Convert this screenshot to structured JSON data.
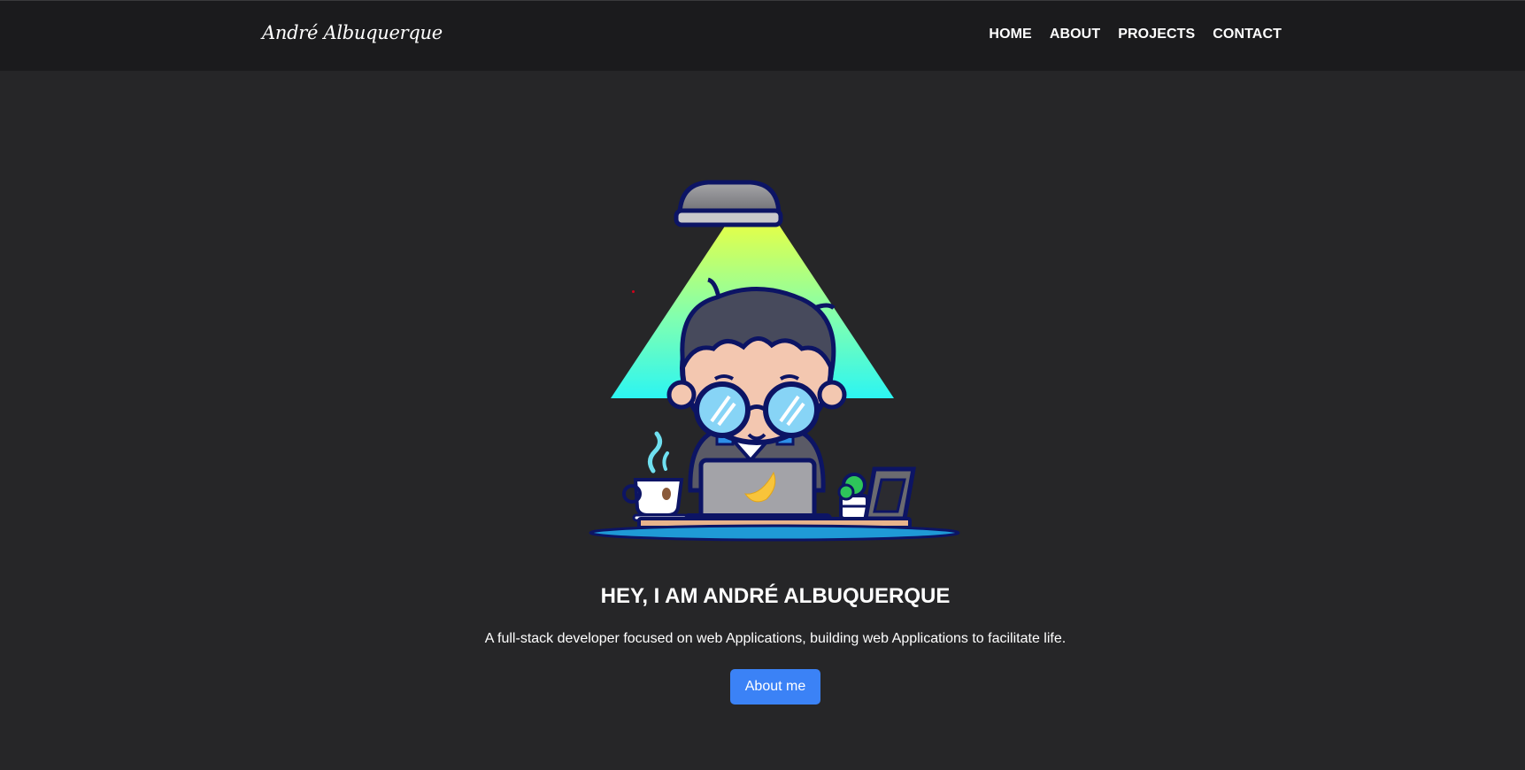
{
  "nav": {
    "brand": "André Albuquerque",
    "links": [
      "HOME",
      "ABOUT",
      "PROJECTS",
      "CONTACT"
    ]
  },
  "hero": {
    "illustration": "developer-at-laptop-under-lamp",
    "title": "HEY, I AM ANDRÉ ALBUQUERQUE",
    "subtitle": "A full-stack developer focused on web Applications, building web Applications to facilitate life.",
    "button_label": "About me"
  },
  "colors": {
    "page_bg": "#262628",
    "navbar_bg": "#1b1b1d",
    "button_bg": "#3b82f6",
    "text": "#ffffff"
  }
}
